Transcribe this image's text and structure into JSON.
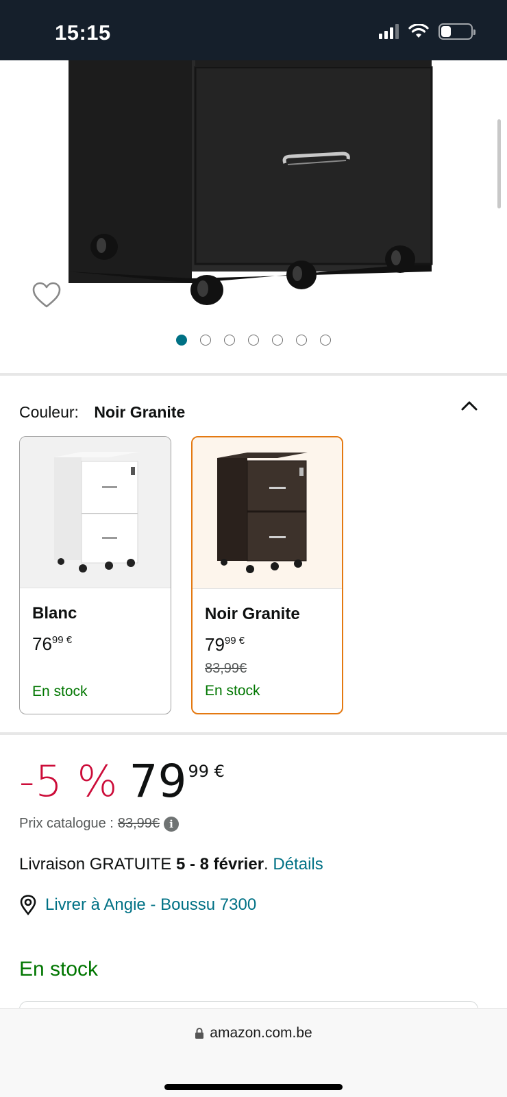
{
  "status_bar": {
    "time": "15:15"
  },
  "gallery": {
    "image_count": 7,
    "active_index": 0
  },
  "color_selector": {
    "label": "Couleur:",
    "selected_value": "Noir Granite",
    "options": [
      {
        "name": "Blanc",
        "price_whole": "76",
        "price_cents": "99 €",
        "list_price": "",
        "stock": "En stock",
        "selected": false
      },
      {
        "name": "Noir Granite",
        "price_whole": "79",
        "price_cents": "99 €",
        "list_price": "83,99€",
        "stock": "En stock",
        "selected": true
      }
    ]
  },
  "price": {
    "discount": "-5 %",
    "whole": "79",
    "cents": "99 €",
    "list_price_label": "Prix catalogue :",
    "list_price": "83,99€"
  },
  "delivery": {
    "prefix": "Livraison GRATUITE",
    "dates": "5 - 8 février",
    "suffix": ".",
    "details_link": "Détails"
  },
  "location": {
    "text": "Livrer à Angie - Boussu 7300"
  },
  "availability": "En stock",
  "browser": {
    "url": "amazon.com.be"
  },
  "colors": {
    "link": "#007185",
    "deal_red": "#cc0c39",
    "stock_green": "#007600",
    "selected_border": "#e47911",
    "active_dot": "#007185"
  }
}
